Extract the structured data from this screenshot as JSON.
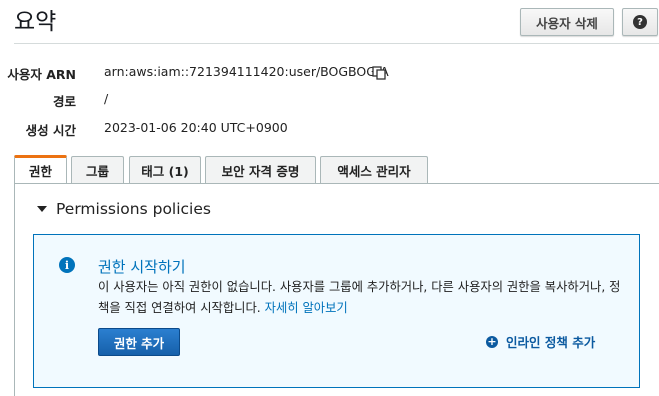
{
  "header": {
    "title": "요약",
    "delete_user_label": "사용자 삭제",
    "help_glyph": "?"
  },
  "summary": {
    "user_arn_label": "사용자 ARN",
    "user_arn_value": "arn:aws:iam::721394111420:user/BOGBOG-A",
    "path_label": "경로",
    "path_value": "/",
    "created_label": "생성 시간",
    "created_value": "2023-01-06 20:40 UTC+0900"
  },
  "tabs": [
    {
      "label": "권한",
      "active": true
    },
    {
      "label": "그룹",
      "active": false
    },
    {
      "label": "태그 (1)",
      "active": false
    },
    {
      "label": "보안 자격 증명",
      "active": false
    },
    {
      "label": "액세스 관리자",
      "active": false
    }
  ],
  "permissions": {
    "section_title": "Permissions policies",
    "info_heading": "권한 시작하기",
    "info_text": "이 사용자는 아직 권한이 없습니다. 사용자를 그룹에 추가하거나, 다른 사용자의 권한을 복사하거나, 정책을 직접 연결하여 시작합니다.",
    "info_link": "자세히 알아보기",
    "add_permissions_label": "권한 추가",
    "add_inline_policy_label": "인라인 정책 추가"
  },
  "colors": {
    "accent_tab": "#ec7211",
    "link_blue": "#0073bb",
    "primary_button": "#1660aa"
  }
}
